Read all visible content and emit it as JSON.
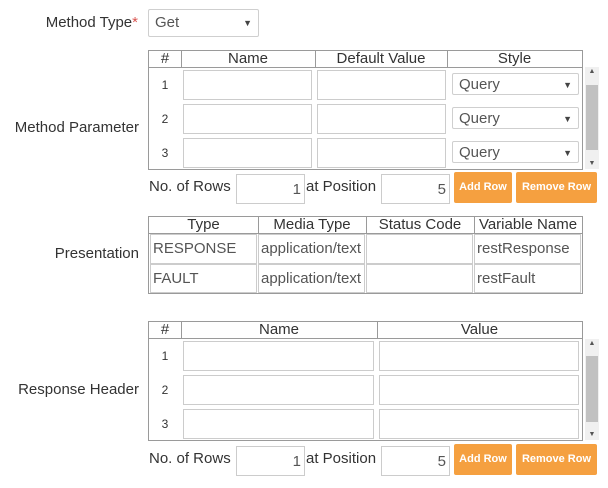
{
  "method_type": {
    "label": "Method Type",
    "required_mark": "*",
    "value": "Get"
  },
  "method_parameter": {
    "label": "Method Parameter",
    "columns": [
      "#",
      "Name",
      "Default Value",
      "Style"
    ],
    "rows": [
      {
        "num": "1",
        "name": "",
        "default_value": "",
        "style": "Query"
      },
      {
        "num": "2",
        "name": "",
        "default_value": "",
        "style": "Query"
      },
      {
        "num": "3",
        "name": "",
        "default_value": "",
        "style": "Query"
      }
    ],
    "no_of_rows_label": "No. of Rows",
    "no_of_rows_value": "1",
    "at_position_label": "at Position",
    "at_position_value": "5",
    "add_row": "Add Row",
    "remove_row": "Remove Row"
  },
  "presentation": {
    "label": "Presentation",
    "columns": [
      "Type",
      "Media Type",
      "Status Code",
      "Variable Name"
    ],
    "rows": [
      {
        "type": "RESPONSE",
        "media_type": "application/text",
        "status_code": "",
        "variable_name": "restResponse"
      },
      {
        "type": "FAULT",
        "media_type": "application/text",
        "status_code": "",
        "variable_name": "restFault"
      }
    ]
  },
  "response_header": {
    "label": "Response Header",
    "columns": [
      "#",
      "Name",
      "Value"
    ],
    "rows": [
      {
        "num": "1",
        "name": "",
        "value": ""
      },
      {
        "num": "2",
        "name": "",
        "value": ""
      },
      {
        "num": "3",
        "name": "",
        "value": ""
      }
    ],
    "no_of_rows_label": "No. of Rows",
    "no_of_rows_value": "1",
    "at_position_label": "at Position",
    "at_position_value": "5",
    "add_row": "Add Row",
    "remove_row": "Remove Row"
  }
}
